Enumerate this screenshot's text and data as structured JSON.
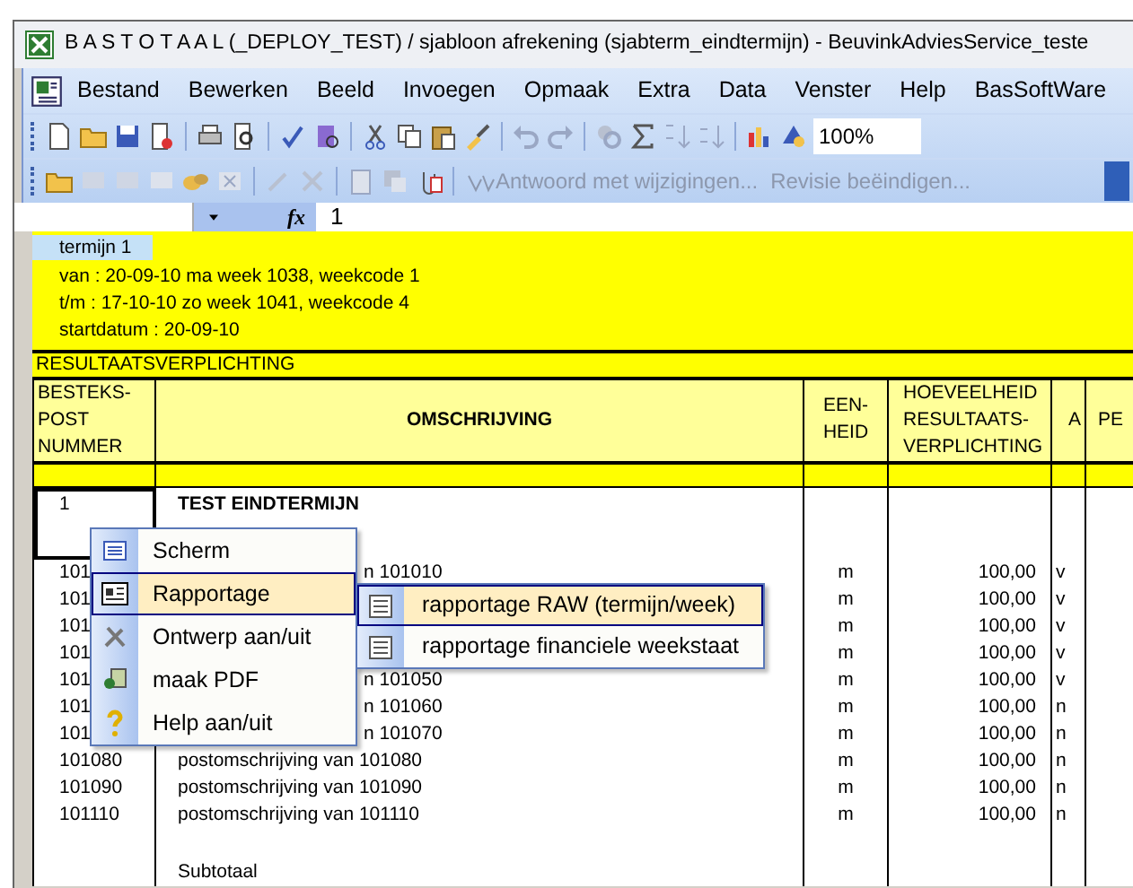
{
  "window": {
    "title": "B A S T O T A A L  (_DEPLOY_TEST)  / sjabloon afrekening (sjabterm_eindtermijn) - BeuvinkAdviesService_teste"
  },
  "menu_bar": [
    {
      "label": "Bestand"
    },
    {
      "label": "Bewerken"
    },
    {
      "label": "Beeld"
    },
    {
      "label": "Invoegen"
    },
    {
      "label": "Opmaak"
    },
    {
      "label": "Extra"
    },
    {
      "label": "Data"
    },
    {
      "label": "Venster"
    },
    {
      "label": "Help"
    },
    {
      "label": "BasSoftWare"
    }
  ],
  "toolbar": {
    "zoom": "100%"
  },
  "review_toolbar": {
    "buttons": [
      {
        "label": "Antwoord met wijzigingen...",
        "disabled": true
      },
      {
        "label": "Revisie beëindigen...",
        "disabled": true
      }
    ]
  },
  "formula_bar": {
    "function_label": "fx",
    "value": "1"
  },
  "sheet": {
    "termijn": {
      "label": "termijn 1",
      "lines": [
        "van : 20-09-10 ma week 1038, weekcode 1",
        "t/m : 17-10-10 zo week 1041, weekcode 4",
        "startdatum   : 20-09-10"
      ]
    },
    "section": "RESULTAATSVERPLICHTING",
    "columns": [
      [
        "BESTEKS-",
        "POST",
        "NUMMER"
      ],
      [
        "OMSCHRIJVING"
      ],
      [
        "EEN-",
        "HEID"
      ],
      [
        "HOEVEELHEID",
        "RESULTAATS-",
        "VERPLICHTING"
      ],
      [
        "A"
      ],
      [
        "PE"
      ]
    ],
    "rows": [
      {
        "kind": "heading",
        "number": "1",
        "description": "TEST EINDTERMIJN",
        "selected": true
      },
      {
        "kind": "item",
        "number": "101",
        "description": "n 101010",
        "unit": "m",
        "quantity": "100,00",
        "a": "v"
      },
      {
        "kind": "item",
        "number": "101",
        "unit": "m",
        "quantity": "100,00",
        "a": "v"
      },
      {
        "kind": "item",
        "number": "101",
        "unit": "m",
        "quantity": "100,00",
        "a": "v"
      },
      {
        "kind": "item",
        "number": "101",
        "unit": "m",
        "quantity": "100,00",
        "a": "v"
      },
      {
        "kind": "item",
        "number": "101",
        "description": "n 101050",
        "unit": "m",
        "quantity": "100,00",
        "a": "v"
      },
      {
        "kind": "item",
        "number": "101",
        "description": "n 101060",
        "unit": "m",
        "quantity": "100,00",
        "a": "n"
      },
      {
        "kind": "item",
        "number": "101",
        "description": "n 101070",
        "unit": "m",
        "quantity": "100,00",
        "a": "n"
      },
      {
        "kind": "item",
        "number": "101080",
        "description": "postomschrijving van 101080",
        "unit": "m",
        "quantity": "100,00",
        "a": "n"
      },
      {
        "kind": "item",
        "number": "101090",
        "description": "postomschrijving van 101090",
        "unit": "m",
        "quantity": "100,00",
        "a": "n"
      },
      {
        "kind": "item",
        "number": "101110",
        "description": "postomschrijving van 101110",
        "unit": "m",
        "quantity": "100,00",
        "a": "n"
      },
      {
        "kind": "blank"
      },
      {
        "kind": "subtotal",
        "description": "Subtotaal"
      }
    ]
  },
  "context_menu": {
    "items": [
      {
        "label": "Scherm",
        "selected": false
      },
      {
        "label": "Rapportage",
        "selected": true
      },
      {
        "label": "Ontwerp aan/uit",
        "selected": false
      },
      {
        "label": "maak PDF",
        "selected": false
      },
      {
        "label": "Help aan/uit",
        "selected": false
      }
    ]
  },
  "submenu": {
    "items": [
      {
        "label": "rapportage RAW (termijn/week)",
        "selected": true
      },
      {
        "label": "rapportage financiele weekstaat",
        "selected": false
      }
    ]
  }
}
